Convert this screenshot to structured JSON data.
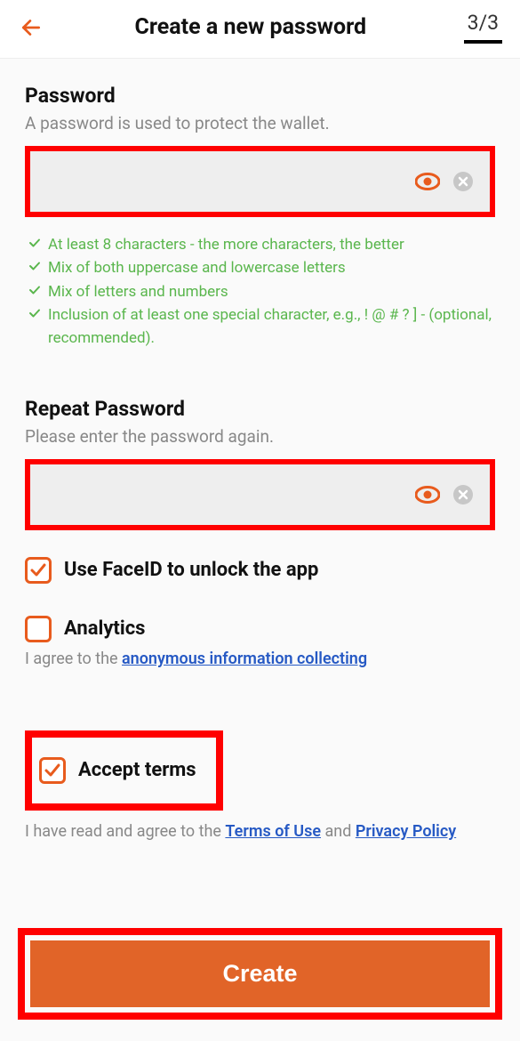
{
  "header": {
    "title": "Create a new password",
    "step": "3/3"
  },
  "password": {
    "label": "Password",
    "desc": "A password is used to protect the wallet.",
    "value": "",
    "rules": [
      "At least 8 characters - the more characters, the better",
      "Mix of both uppercase and lowercase letters",
      "Mix of letters and numbers",
      "Inclusion of at least one special character, e.g., ! @ # ? ] - (optional, recommended)."
    ]
  },
  "repeat": {
    "label": "Repeat Password",
    "desc": "Please enter the password again.",
    "value": ""
  },
  "faceid": {
    "checked": true,
    "label": "Use FaceID to unlock the app"
  },
  "analytics": {
    "checked": false,
    "label": "Analytics",
    "agree_prefix": "I agree to the ",
    "agree_link": "anonymous information collecting"
  },
  "terms": {
    "checked": true,
    "label": "Accept terms",
    "agree_prefix": "I have read and agree to the ",
    "terms_link": "Terms of Use",
    "and": " and ",
    "privacy_link": "Privacy Policy"
  },
  "create_label": "Create"
}
